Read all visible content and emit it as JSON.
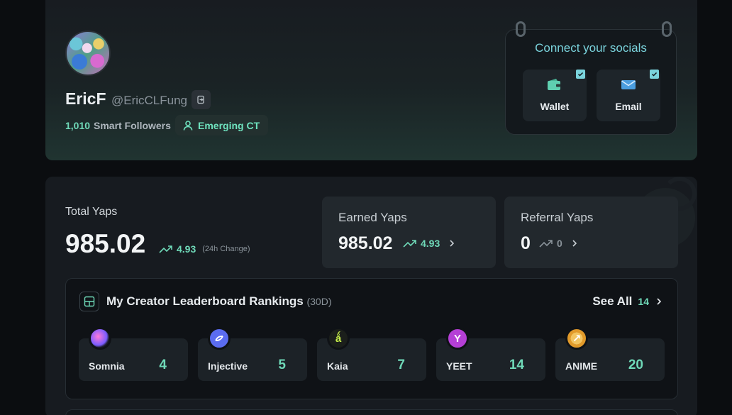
{
  "profile": {
    "display_name": "EricF",
    "handle": "@EricCLFung",
    "smart_followers_count": "1,010",
    "smart_followers_label": "Smart Followers",
    "tier_badge": "Emerging CT"
  },
  "socials": {
    "title": "Connect your socials",
    "items": [
      {
        "label": "Wallet",
        "icon": "wallet-icon",
        "connected": true
      },
      {
        "label": "Email",
        "icon": "envelope-icon",
        "connected": true
      }
    ]
  },
  "yaps": {
    "total_label": "Total Yaps",
    "total_value": "985.02",
    "total_change": "4.93",
    "total_change_note": "(24h Change)",
    "earned_label": "Earned Yaps",
    "earned_value": "985.02",
    "earned_change": "4.93",
    "referral_label": "Referral Yaps",
    "referral_value": "0",
    "referral_change": "0"
  },
  "leaderboard": {
    "title": "My Creator Leaderboard Rankings",
    "period": "(30D)",
    "see_all_label": "See All",
    "see_all_count": "14",
    "projects": [
      {
        "name": "Somnia",
        "rank": "4",
        "logo_color": "#7a5cff"
      },
      {
        "name": "Injective",
        "rank": "5",
        "logo_color": "#5b6cf0"
      },
      {
        "name": "Kaia",
        "rank": "7",
        "logo_color": "#1b1f1b"
      },
      {
        "name": "YEET",
        "rank": "14",
        "logo_color": "#b53fd6"
      },
      {
        "name": "ANIME",
        "rank": "20",
        "logo_color": "#e19a2a"
      }
    ]
  },
  "colors": {
    "accent": "#6fd9b8",
    "socials_accent": "#7ad3dc",
    "background": "#0b0d10"
  }
}
